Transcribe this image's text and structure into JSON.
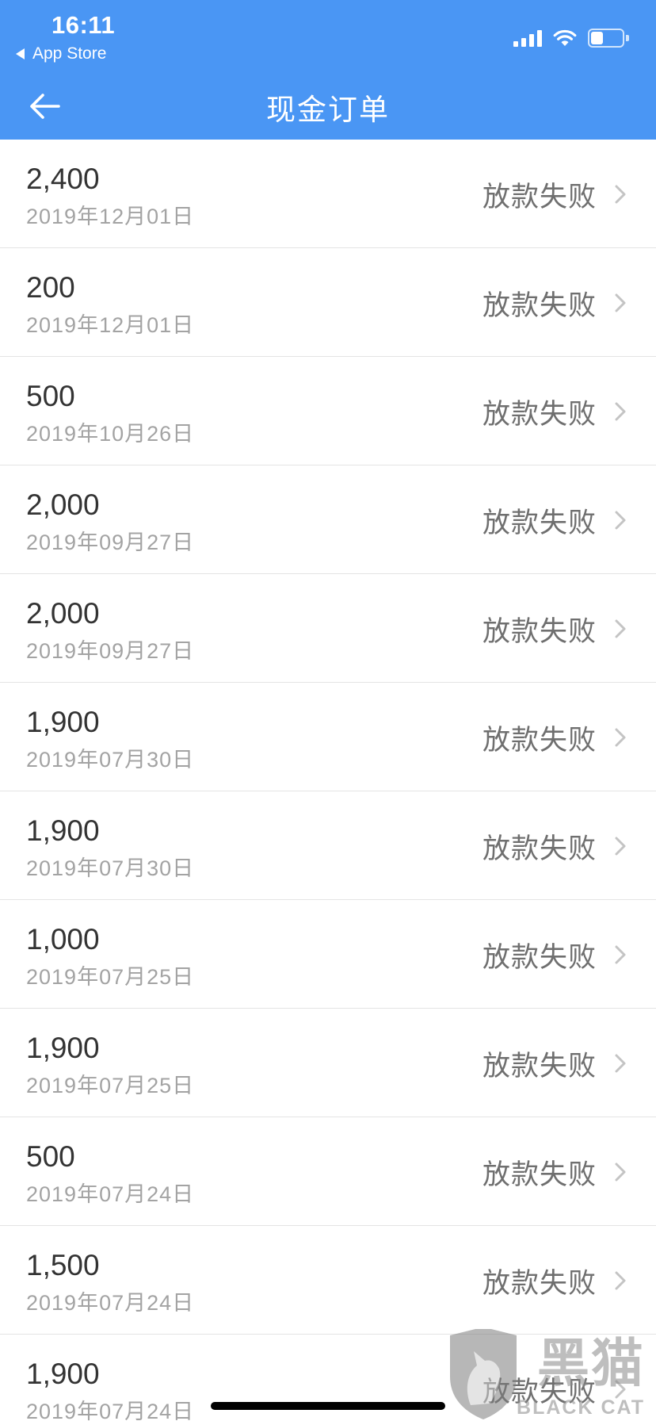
{
  "status_bar": {
    "time": "16:11",
    "back_app_label": "App Store",
    "battery_level_percent": 40
  },
  "nav": {
    "title": "现金订单",
    "back_icon": "arrow-left-icon"
  },
  "orders": [
    {
      "amount": "2,400",
      "date": "2019年12月01日",
      "status": "放款失败"
    },
    {
      "amount": "200",
      "date": "2019年12月01日",
      "status": "放款失败"
    },
    {
      "amount": "500",
      "date": "2019年10月26日",
      "status": "放款失败"
    },
    {
      "amount": "2,000",
      "date": "2019年09月27日",
      "status": "放款失败"
    },
    {
      "amount": "2,000",
      "date": "2019年09月27日",
      "status": "放款失败"
    },
    {
      "amount": "1,900",
      "date": "2019年07月30日",
      "status": "放款失败"
    },
    {
      "amount": "1,900",
      "date": "2019年07月30日",
      "status": "放款失败"
    },
    {
      "amount": "1,000",
      "date": "2019年07月25日",
      "status": "放款失败"
    },
    {
      "amount": "1,900",
      "date": "2019年07月25日",
      "status": "放款失败"
    },
    {
      "amount": "500",
      "date": "2019年07月24日",
      "status": "放款失败"
    },
    {
      "amount": "1,500",
      "date": "2019年07月24日",
      "status": "放款失败"
    },
    {
      "amount": "1,900",
      "date": "2019年07月24日",
      "status": "放款失败"
    }
  ],
  "watermark": {
    "text_cn": "黑猫",
    "text_en": "BLACK CAT"
  },
  "colors": {
    "accent": "#4a96f4",
    "amount_text": "#333333",
    "date_text": "#a3a3a3",
    "status_text": "#6f6f6f",
    "divider": "#e4e4e4"
  }
}
